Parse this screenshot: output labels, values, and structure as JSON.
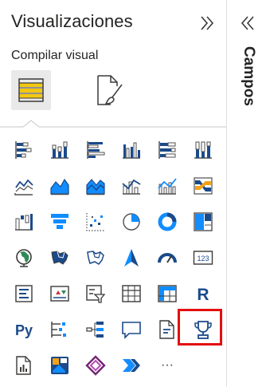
{
  "visualizations_pane": {
    "title": "Visualizaciones",
    "collapse_icon": "double-chevron-right-icon",
    "section_label": "Compilar visual",
    "tabs": [
      {
        "name": "build-visual",
        "icon": "build-visual-icon",
        "selected": true
      },
      {
        "name": "format-visual",
        "icon": "format-paintbrush-icon",
        "selected": false
      }
    ],
    "visuals": [
      {
        "icon": "stacked-bar-chart-icon"
      },
      {
        "icon": "stacked-column-chart-icon"
      },
      {
        "icon": "clustered-bar-chart-icon"
      },
      {
        "icon": "clustered-column-chart-icon"
      },
      {
        "icon": "100-stacked-bar-chart-icon"
      },
      {
        "icon": "100-stacked-column-chart-icon"
      },
      {
        "icon": "line-chart-icon"
      },
      {
        "icon": "area-chart-icon"
      },
      {
        "icon": "stacked-area-chart-icon"
      },
      {
        "icon": "line-and-stacked-column-chart-icon"
      },
      {
        "icon": "line-and-clustered-column-chart-icon"
      },
      {
        "icon": "ribbon-chart-icon"
      },
      {
        "icon": "waterfall-chart-icon"
      },
      {
        "icon": "funnel-icon"
      },
      {
        "icon": "scatter-chart-icon"
      },
      {
        "icon": "pie-chart-icon"
      },
      {
        "icon": "donut-chart-icon"
      },
      {
        "icon": "treemap-icon"
      },
      {
        "icon": "map-icon"
      },
      {
        "icon": "filled-map-icon"
      },
      {
        "icon": "shape-map-icon"
      },
      {
        "icon": "azure-map-icon"
      },
      {
        "icon": "gauge-icon"
      },
      {
        "icon": "card-icon",
        "text": "123"
      },
      {
        "icon": "multi-row-card-icon"
      },
      {
        "icon": "kpi-icon"
      },
      {
        "icon": "slicer-icon"
      },
      {
        "icon": "table-icon"
      },
      {
        "icon": "matrix-icon"
      },
      {
        "icon": "r-script-visual-icon",
        "text": "R"
      },
      {
        "icon": "python-visual-icon",
        "text": "Py"
      },
      {
        "icon": "key-influencers-icon"
      },
      {
        "icon": "decomposition-tree-icon"
      },
      {
        "icon": "qa-icon"
      },
      {
        "icon": "smart-narrative-icon"
      },
      {
        "icon": "trophy-icon",
        "highlighted": true
      },
      {
        "icon": "paginated-report-icon"
      },
      {
        "icon": "power-apps-icon"
      },
      {
        "icon": "power-automate-icon"
      },
      {
        "icon": "more-options-icon",
        "text": "···"
      }
    ]
  },
  "fields_pane": {
    "expand_icon": "double-chevron-left-icon",
    "title": "Campos"
  },
  "colors": {
    "accent_blue": "#118dff",
    "dark_blue": "#1b4a8a",
    "icon_gray": "#4f4f4f",
    "highlight_red": "#e30e0e",
    "build_tab_bg": "#e9e9e9",
    "build_tab_yellow": "#f2c811"
  }
}
